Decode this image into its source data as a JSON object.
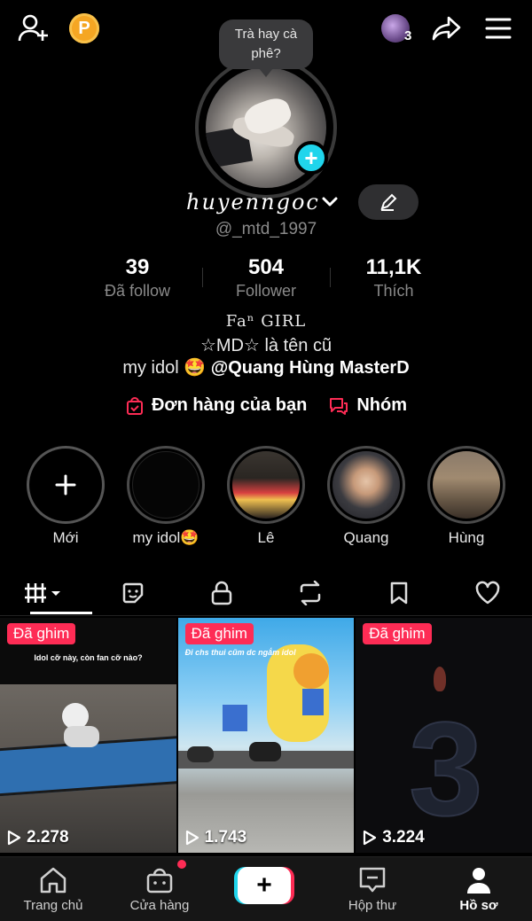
{
  "header": {
    "coin_letter": "P",
    "mini_avatar_count": "3",
    "bubble_text": "Trà hay cà phê?"
  },
  "profile": {
    "display_name": "𝓱𝓾𝔂𝓮𝓷𝓷𝓰𝓸𝓬",
    "display_name_plain": "huyenngoc",
    "handle": "@_mtd_1997",
    "stats": [
      {
        "value": "39",
        "label": "Đã follow"
      },
      {
        "value": "504",
        "label": "Follower"
      },
      {
        "value": "11,1K",
        "label": "Thích"
      }
    ],
    "bio_line1": "Faⁿ GIRL",
    "bio_line2": "☆MD☆ là tên cũ",
    "bio_line3_prefix": "my idol 🤩 ",
    "bio_line3_mention": "@Quang Hùng MasterD"
  },
  "links": {
    "orders": "Đơn hàng của bạn",
    "group": "Nhóm"
  },
  "highlights": [
    {
      "label": "Mới"
    },
    {
      "label": "my idol🤩"
    },
    {
      "label": "Lê"
    },
    {
      "label": "Quang"
    },
    {
      "label": "Hùng"
    }
  ],
  "tabs": [
    "videos-grid",
    "sticker",
    "lock",
    "repost",
    "bookmark",
    "heart"
  ],
  "videos": [
    {
      "pin": "Đã ghim",
      "views": "2.278",
      "caption": "Idol cỡ này, còn fan cỡ nào?"
    },
    {
      "pin": "Đã ghim",
      "views": "1.743",
      "caption": "Đi chs thui cũm dc ngắm idol"
    },
    {
      "pin": "Đã ghim",
      "views": "3.224",
      "caption": ""
    }
  ],
  "bottom_nav": {
    "home": "Trang chủ",
    "shop": "Cửa hàng",
    "inbox": "Hộp thư",
    "profile": "Hồ sơ"
  },
  "colors": {
    "accent_red": "#fe2c55",
    "accent_cyan": "#20d5ec",
    "coin": "#f5a623"
  }
}
